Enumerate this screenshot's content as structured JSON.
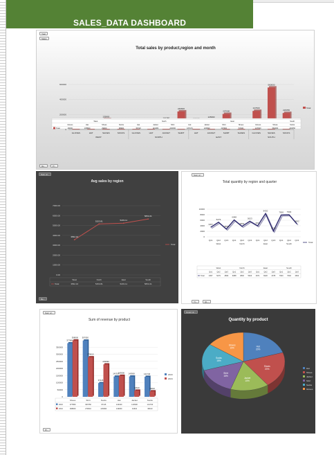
{
  "dashboard": {
    "title": "SALES_DATA DASHBOARD"
  },
  "chips": {
    "p1a": "Year",
    "p1b": "Sales",
    "p1c": "Re...",
    "p1d": "Pr...",
    "p2a": "Sum of...",
    "p2b": "Re...",
    "p3a": "Sum of...",
    "p3b": "Yr...",
    "p3c": "Qt...",
    "p4a": "Sum of...",
    "p4b": "Pr...",
    "p5a": "Count of..."
  },
  "chart_data": [
    {
      "type": "bar",
      "title": "Total sales by product,region and month",
      "ylim": [
        0,
        600000
      ],
      "yticks": [
        0,
        200000,
        400000,
        600000
      ],
      "legend": "right",
      "series": [
        {
          "name": "Total",
          "color": "#c0504d"
        }
      ],
      "regions": [
        {
          "name": "WEST",
          "products": [
            {
              "product": "GLOVES",
              "value": 49000
            },
            {
              "product": "HAT",
              "value": 60000
            },
            {
              "product": "SHOES",
              "value": 135800
            },
            {
              "product": "SOCKS",
              "value": 29900
            }
          ]
        },
        {
          "name": "NORTH",
          "products": [
            {
              "product": "GLOVES",
              "value": 68900
            },
            {
              "product": "HAT",
              "value": 56720
            },
            {
              "product": "JACKET",
              "value": 116280
            },
            {
              "product": "SHIRT",
              "value": 240600
            }
          ]
        },
        {
          "name": "EAST",
          "products": [
            {
              "product": "HAT",
              "value": 105170
            },
            {
              "product": "JACKET",
              "value": 126990
            },
            {
              "product": "SHIRT",
              "value": 207600
            },
            {
              "product": "SHOES",
              "value": 57200
            }
          ]
        },
        {
          "name": "SOUTH",
          "products": [
            {
              "product": "GLOVES",
              "value": 247600
            },
            {
              "product": "SHOES",
              "value": 560000
            },
            {
              "product": "SOCKS",
              "value": 220050
            }
          ]
        }
      ],
      "table": {
        "region_row": [
          "West",
          "North",
          "East",
          "South"
        ],
        "product_row": [
          "Gloves",
          "Hat",
          "Shoes",
          "Socks",
          "Hat",
          "Jacket",
          "Shirt",
          "Hat",
          "Jacket",
          "Shirt",
          "Shoes",
          "Gloves",
          "Shoes",
          "Socks"
        ],
        "row_label": "Total",
        "values": [
          "49000",
          "135800",
          "29900",
          "68900",
          "56720",
          "116280",
          "240600",
          "105170",
          "126990",
          "207600",
          "57200",
          "247600",
          "560000",
          "220050"
        ]
      }
    },
    {
      "type": "line",
      "title": "Avg sales by region",
      "categories": [
        "West",
        "North",
        "East",
        "South"
      ],
      "series": [
        {
          "name": "Total",
          "values": [
            3562.16,
            5153.81,
            5233.11,
            5653.21
          ],
          "color": "#c0504d"
        }
      ],
      "data_labels": [
        "3562.16",
        "5153.81",
        "5233.11",
        "5653.21"
      ],
      "ylim": [
        0,
        7000
      ],
      "yticks": [
        "0.00",
        "1000.00",
        "2000.00",
        "3000.00",
        "4000.00",
        "5000.00",
        "6000.00",
        "7000.00"
      ],
      "legend": "right",
      "table": {
        "row_label": "Total",
        "values": [
          "3562.16",
          "5153.81",
          "5233.11",
          "5653.21"
        ]
      }
    },
    {
      "type": "line",
      "title": "Total quantity by region and quarter",
      "regions": [
        "West",
        "North",
        "East",
        "South"
      ],
      "quarters": [
        "Qtr1",
        "Qtr2",
        "Qtr3",
        "Qtr4"
      ],
      "series": [
        {
          "name": "Total",
          "color": "#2e2a6e",
          "values": [
            3457,
            5279,
            2809,
            6088,
            3802,
            5623,
            3971,
            8420,
            2078,
            7900,
            7994,
            4662
          ]
        }
      ],
      "ylim": [
        0,
        10000
      ],
      "yticks": [
        "0",
        "2000",
        "4000",
        "6000",
        "8000",
        "10000"
      ],
      "legend": "right",
      "table": {
        "quarter_row": [
          "Qtr1",
          "Qtr2",
          "Qtr3",
          "Qtr1",
          "Qtr2",
          "Qtr3",
          "Qtr1",
          "Qtr2",
          "Qtr3",
          "Qtr1",
          "Qtr2",
          "Qtr3"
        ],
        "row_label": "Total",
        "values": [
          "3457",
          "5279",
          "2809",
          "6088",
          "3802",
          "5623",
          "3971",
          "8420",
          "2078",
          "7900",
          "7994",
          "4662"
        ]
      }
    },
    {
      "type": "bar",
      "title": "Sum of revenue by product",
      "categories": [
        "Shoes",
        "Shirt",
        "Socks",
        "Hat",
        "Jacket",
        "Socks"
      ],
      "series": [
        {
          "name": "2023",
          "values": [
            377860,
            397050,
            97115,
            143320,
            143900,
            141740
          ],
          "color": "#4f81bd"
        },
        {
          "name": "2024",
          "values": [
            398000,
            279610,
            229090,
            149300,
            44610,
            39610
          ],
          "color": "#c0504d"
        }
      ],
      "data_labels_2023": [
        "377860",
        "397050",
        "97115",
        "143320",
        "143900",
        "141740"
      ],
      "data_labels_2024": [
        "398000",
        "279610",
        "229090",
        "149300",
        "44610",
        "39610"
      ],
      "ylim": [
        0,
        400000
      ],
      "yticks": [
        "0",
        "50000",
        "100000",
        "150000",
        "200000",
        "250000",
        "300000",
        "350000"
      ],
      "legend": "right",
      "table": {
        "rows": [
          {
            "label": "2023",
            "values": [
              "377860",
              "397050",
              "97115",
              "143320",
              "143900",
              "141740"
            ]
          },
          {
            "label": "2024",
            "values": [
              "398000",
              "279610",
              "229090",
              "149300",
              "44610",
              "39610"
            ]
          }
        ]
      }
    },
    {
      "type": "pie",
      "title": "Quantity by product",
      "slices": [
        {
          "label": "Hat",
          "percent": 20,
          "color": "#4f81bd"
        },
        {
          "label": "Shoes",
          "percent": 20,
          "color": "#c0504d"
        },
        {
          "label": "Jacket",
          "percent": 15,
          "color": "#9bbb59"
        },
        {
          "label": "Shirt",
          "percent": 15,
          "color": "#8064a2"
        },
        {
          "label": "Socks",
          "percent": 15,
          "color": "#4bacc6"
        },
        {
          "label": "Gloves",
          "percent": 15,
          "color": "#f79646"
        }
      ],
      "legend": "right"
    }
  ]
}
